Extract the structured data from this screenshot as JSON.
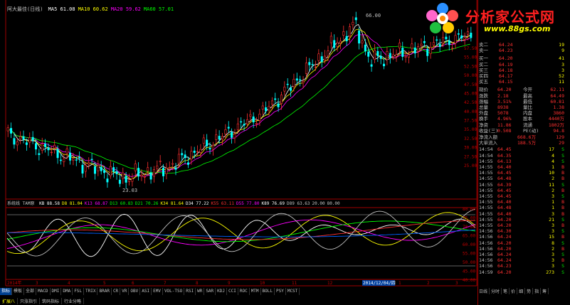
{
  "header": {
    "title": "阿大最佳(日线)",
    "mas": [
      {
        "label": "MA5",
        "value": "61.08",
        "color": "#ffffff"
      },
      {
        "label": "MA10",
        "value": "60.62",
        "color": "#ffff00"
      },
      {
        "label": "MA20",
        "value": "59.62",
        "color": "#ff00ff"
      },
      {
        "label": "MA60",
        "value": "57.01",
        "color": "#00ff00"
      }
    ]
  },
  "price_axis": [
    "57.50",
    "55.00",
    "52.50",
    "50.00",
    "47.50",
    "45.00",
    "42.50",
    "40.00",
    "37.50",
    "35.00",
    "32.50",
    "30.00",
    "27.50",
    "25.00"
  ],
  "annotations": {
    "high": "66.00",
    "low": "23.03"
  },
  "indicator": {
    "name": "系统线 TAM原",
    "values": [
      {
        "t": "KB 88.58",
        "c": "#ffffff"
      },
      {
        "t": "D8 81.04",
        "c": "#ffff00"
      },
      {
        "t": "K13 68.87",
        "c": "#ff00ff"
      },
      {
        "t": "D13 60.83",
        "c": "#00ff00"
      },
      {
        "t": "D21 70.26",
        "c": "#00ff00"
      },
      {
        "t": "K34 81.64",
        "c": "#ffff00"
      },
      {
        "t": "D34 77.22",
        "c": "#ffffff"
      },
      {
        "t": "K55 63.11",
        "c": "#ff3030"
      },
      {
        "t": "D55 77.80",
        "c": "#ff00ff"
      },
      {
        "t": "K89 76.69",
        "c": "#ffffff"
      },
      {
        "t": "D89 63.63",
        "c": "#c0c0c0"
      },
      {
        "t": "20.00",
        "c": "#c0c0c0"
      },
      {
        "t": "80.00",
        "c": "#c0c0c0"
      }
    ],
    "axis": [
      "80.00",
      "75.00",
      "70.00",
      "65.00",
      "60.00",
      "55.00",
      "50.00",
      "45.00",
      "40.00"
    ]
  },
  "time_axis": [
    "2014年",
    "3",
    "4",
    "5",
    "6",
    "7",
    "8",
    "9",
    "10",
    "11",
    "12",
    "2014/12/04/四",
    "1",
    "2",
    "3"
  ],
  "tabs": [
    "指标",
    "模板",
    "全部",
    "MACD",
    "DMI",
    "DMA",
    "FSL",
    "TRIX",
    "BRAR",
    "CR",
    "VR",
    "OBV",
    "ASI",
    "EMV",
    "VOL-TSO",
    "RSI",
    "WR",
    "SAR",
    "KDJ",
    "CCI",
    "ROC",
    "MTM",
    "BOLL",
    "PSY",
    "MCST"
  ],
  "tabs2": [
    "扩展八",
    "只涨指引",
    "筑码指标",
    "行业分略"
  ],
  "logo": {
    "title": "分析家公式网",
    "url": "www.88gs.com"
  },
  "quote": {
    "asks": [
      {
        "l": "卖二",
        "p": "64.24",
        "v": "19"
      },
      {
        "l": "卖一",
        "p": "64.23",
        "v": "9"
      }
    ],
    "bids": [
      {
        "l": "买一",
        "p": "64.20",
        "v": "41"
      },
      {
        "l": "买二",
        "p": "64.19",
        "v": "3"
      },
      {
        "l": "买三",
        "p": "64.18",
        "v": "3"
      },
      {
        "l": "买四",
        "p": "64.17",
        "v": "52"
      },
      {
        "l": "买五",
        "p": "64.15",
        "v": "11"
      }
    ],
    "stats": [
      {
        "l": "现价",
        "a": "64.20",
        "l2": "今开",
        "b": "62.11"
      },
      {
        "l": "涨跌",
        "a": "2.18",
        "l2": "最高",
        "b": "64.49"
      },
      {
        "l": "涨幅",
        "a": "3.51%",
        "l2": "最低",
        "b": "60.81"
      },
      {
        "l": "总量",
        "a": "8938",
        "l2": "量比",
        "b": "1.38"
      },
      {
        "l": "外盘",
        "a": "5078",
        "l2": "内盘",
        "b": "3860"
      },
      {
        "l": "换手",
        "a": "4.96%",
        "l2": "股本",
        "b": "4440万"
      },
      {
        "l": "净资",
        "a": "11.86",
        "l2": "流通",
        "b": "1802万"
      },
      {
        "l": "收益(三)",
        "a": "0.508",
        "l2": "PE(动)",
        "b": "94.8"
      }
    ],
    "flow": [
      {
        "l": "净流入额",
        "v": "668.6万",
        "n": "129"
      },
      {
        "l": "大单流入",
        "v": "188.5万",
        "n": "29"
      }
    ],
    "ticks": [
      {
        "t": "14:54",
        "p": "64.45",
        "v": "17",
        "s": "S"
      },
      {
        "t": "14:54",
        "p": "64.35",
        "v": "4",
        "s": "S"
      },
      {
        "t": "14:55",
        "p": "64.13",
        "v": "4",
        "s": "S"
      },
      {
        "t": "14:55",
        "p": "64.40",
        "v": "1",
        "s": "B"
      },
      {
        "t": "14:55",
        "p": "64.45",
        "v": "10",
        "s": "B"
      },
      {
        "t": "14:55",
        "p": "64.48",
        "v": "2",
        "s": "B"
      },
      {
        "t": "14:55",
        "p": "64.39",
        "v": "11",
        "s": "S"
      },
      {
        "t": "14:55",
        "p": "64.45",
        "v": "2",
        "s": "B"
      },
      {
        "t": "14:55",
        "p": "64.45",
        "v": "3",
        "s": "S"
      },
      {
        "t": "14:55",
        "p": "64.40",
        "v": "1",
        "s": "B"
      },
      {
        "t": "14:55",
        "p": "64.48",
        "v": "1",
        "s": "B"
      },
      {
        "t": "14:55",
        "p": "64.40",
        "v": "3",
        "s": "B"
      },
      {
        "t": "14:55",
        "p": "64.20",
        "v": "21",
        "s": "S"
      },
      {
        "t": "14:55",
        "p": "64.20",
        "v": "3",
        "s": "B"
      },
      {
        "t": "14:56",
        "p": "64.30",
        "v": "3",
        "s": "S"
      },
      {
        "t": "14:56",
        "p": "64.24",
        "v": "15",
        "s": "B"
      },
      {
        "t": "14:56",
        "p": "64.20",
        "v": "8",
        "s": "S"
      },
      {
        "t": "14:56",
        "p": "64.20",
        "v": "2",
        "s": "B"
      },
      {
        "t": "14:56",
        "p": "64.24",
        "v": "3",
        "s": "S"
      },
      {
        "t": "14:56",
        "p": "64.24",
        "v": "3",
        "s": "B"
      },
      {
        "t": "14:56",
        "p": "64.23",
        "v": "3",
        "s": "S"
      },
      {
        "t": "14:59",
        "p": "64.20",
        "v": "273",
        "s": "S"
      }
    ],
    "footer_tabs": [
      "日线",
      "分时",
      "笔",
      "价",
      "细",
      "势",
      "指",
      "筹"
    ]
  }
}
